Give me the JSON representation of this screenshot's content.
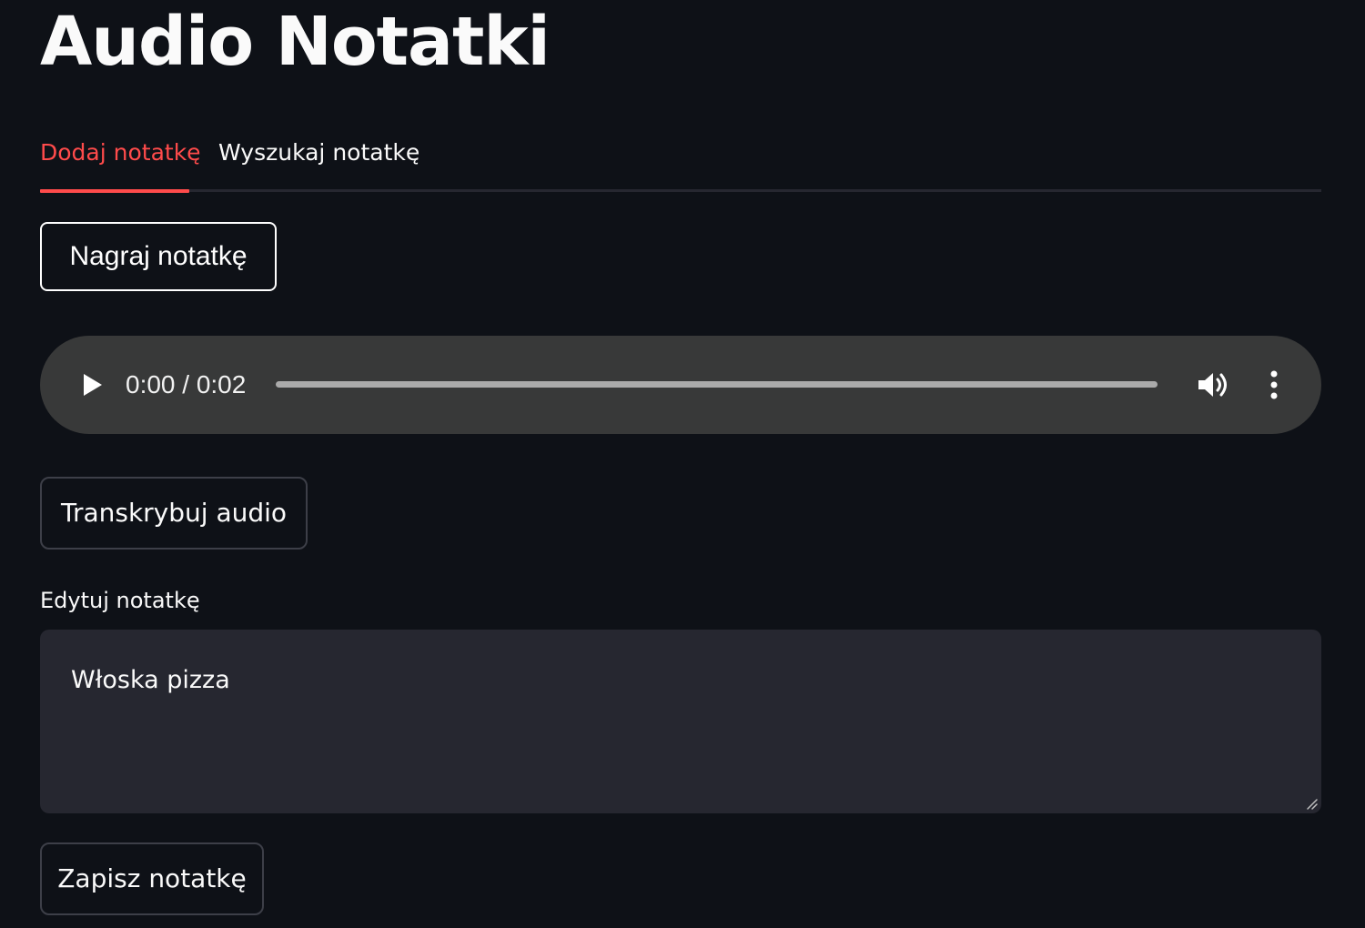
{
  "app": {
    "title": "Audio Notatki"
  },
  "tabs": [
    {
      "label": "Dodaj notatkę",
      "active": true
    },
    {
      "label": "Wyszukaj notatkę",
      "active": false
    }
  ],
  "record": {
    "button_label": "Nagraj notatkę"
  },
  "audio_player": {
    "time_display": "0:00 / 0:02",
    "progress": 0,
    "icons": {
      "play": "play-icon",
      "volume": "volume-icon",
      "more": "more-options-icon"
    }
  },
  "transcribe": {
    "button_label": "Transkrybuj audio"
  },
  "editor": {
    "label": "Edytuj notatkę",
    "value": "Włoska pizza"
  },
  "save": {
    "button_label": "Zapisz notatkę"
  },
  "colors": {
    "background": "#0e1117",
    "accent": "#ff4b4b",
    "player_background": "#383939",
    "input_background": "#262730",
    "text": "#fafafa"
  }
}
